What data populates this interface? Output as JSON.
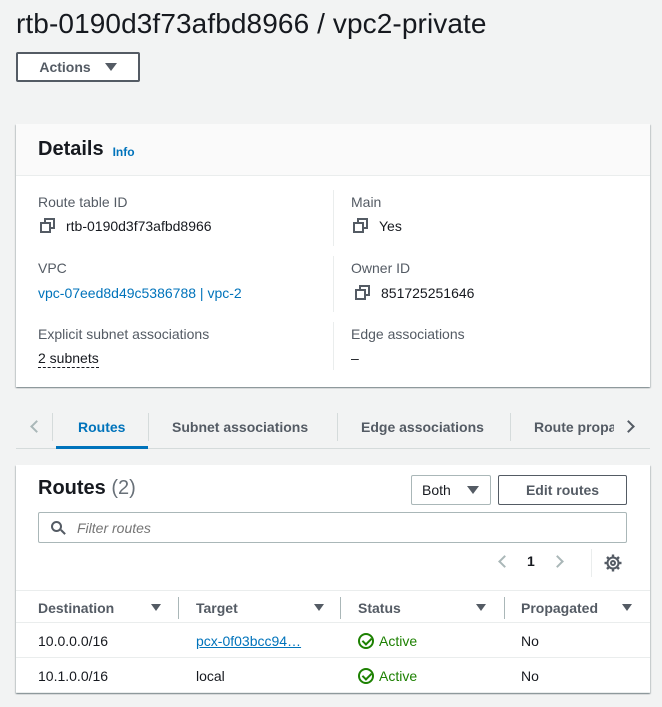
{
  "page": {
    "title": "rtb-0190d3f73afbd8966 / vpc2-private",
    "actions_label": "Actions"
  },
  "details": {
    "title": "Details",
    "info_label": "Info",
    "route_table_id_label": "Route table ID",
    "route_table_id_value": "rtb-0190d3f73afbd8966",
    "main_label": "Main",
    "main_value": "Yes",
    "vpc_label": "VPC",
    "vpc_value": "vpc-07eed8d49c5386788 | vpc-2",
    "owner_id_label": "Owner ID",
    "owner_id_value": "851725251646",
    "explicit_subnet_label": "Explicit subnet associations",
    "explicit_subnet_value": "2 subnets",
    "edge_assoc_label": "Edge associations",
    "edge_assoc_value": "–"
  },
  "tabs": [
    {
      "label": "Routes",
      "active": true
    },
    {
      "label": "Subnet associations",
      "active": false
    },
    {
      "label": "Edge associations",
      "active": false
    },
    {
      "label": "Route propagation",
      "active": false
    }
  ],
  "routes": {
    "title": "Routes",
    "count": "(2)",
    "filter_select": "Both",
    "edit_button": "Edit routes",
    "filter_placeholder": "Filter routes",
    "page_number": "1",
    "columns": [
      "Destination",
      "Target",
      "Status",
      "Propagated"
    ],
    "rows": [
      {
        "destination": "10.0.0.0/16",
        "target": "pcx-0f03bcc94…",
        "status": "Active",
        "propagated": "No"
      },
      {
        "destination": "10.1.0.0/16",
        "target": "local",
        "status": "Active",
        "propagated": "No"
      }
    ]
  },
  "colors": {
    "link": "#0073bb",
    "success": "#1d8102",
    "text": "#16191f",
    "muted": "#545b64",
    "background": "#f2f3f3"
  }
}
